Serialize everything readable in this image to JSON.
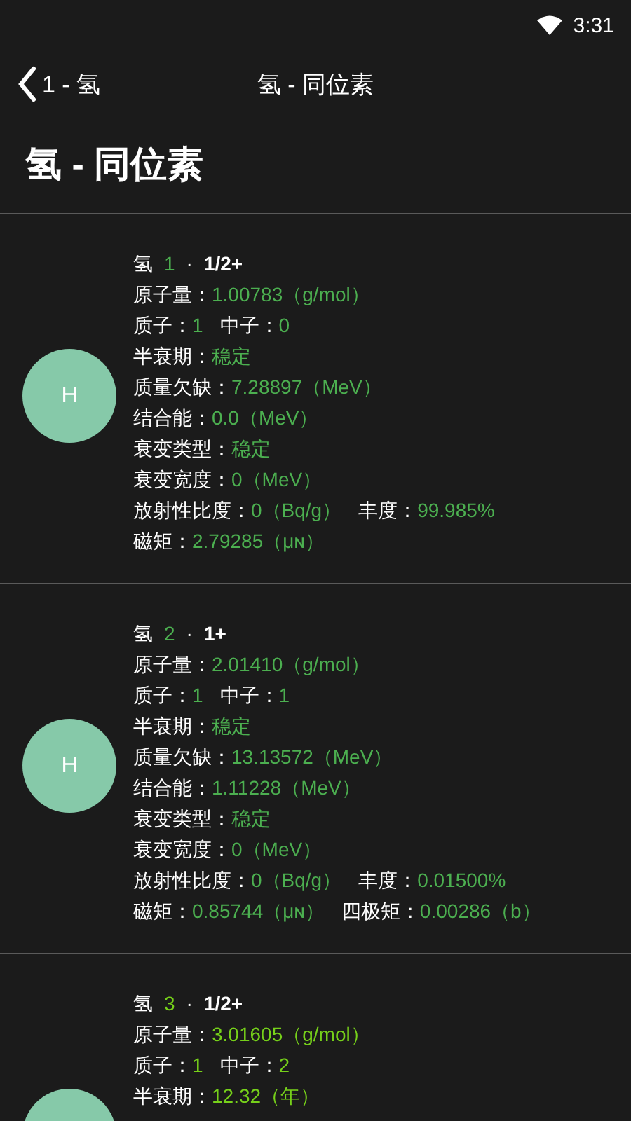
{
  "status_bar": {
    "time": "3:31"
  },
  "nav": {
    "back_label": "1 - 氢",
    "title": "氢 - 同位素"
  },
  "page_title": "氢 - 同位素",
  "isotopes": [
    {
      "symbol": "H",
      "name": "氢",
      "mass_number": "1",
      "separator": "·",
      "spin": "1/2+",
      "color": "#4caf50",
      "lines": [
        {
          "label": "原子量：",
          "value": "1.00783（g/mol）"
        },
        {
          "label": "质子：",
          "value": "1",
          "extra": {
            "label": "中子：",
            "value": "0"
          }
        },
        {
          "label": "半衰期：",
          "value": "稳定"
        },
        {
          "label": "质量欠缺：",
          "value": "7.28897（MeV）"
        },
        {
          "label": "结合能：",
          "value": "0.0（MeV）"
        },
        {
          "label": "衰变类型：",
          "value": "稳定"
        },
        {
          "label": "衰变宽度：",
          "value": "0（MeV）"
        },
        {
          "label": "放射性比度：",
          "value": "0（Bq/g）",
          "extra": {
            "label": "丰度：",
            "value": "99.985%"
          }
        },
        {
          "label": "磁矩：",
          "value": "2.79285（μɴ）"
        }
      ]
    },
    {
      "symbol": "H",
      "name": "氢",
      "mass_number": "2",
      "separator": "·",
      "spin": "1+",
      "color": "#4caf50",
      "lines": [
        {
          "label": "原子量：",
          "value": "2.01410（g/mol）"
        },
        {
          "label": "质子：",
          "value": "1",
          "extra": {
            "label": "中子：",
            "value": "1"
          }
        },
        {
          "label": "半衰期：",
          "value": "稳定"
        },
        {
          "label": "质量欠缺：",
          "value": "13.13572（MeV）"
        },
        {
          "label": "结合能：",
          "value": "1.11228（MeV）"
        },
        {
          "label": "衰变类型：",
          "value": "稳定"
        },
        {
          "label": "衰变宽度：",
          "value": "0（MeV）"
        },
        {
          "label": "放射性比度：",
          "value": "0（Bq/g）",
          "extra": {
            "label": "丰度：",
            "value": "0.01500%"
          }
        },
        {
          "label": "磁矩：",
          "value": "0.85744（μɴ）",
          "extra": {
            "label": "四极矩：",
            "value": "0.00286（b）"
          }
        }
      ]
    },
    {
      "name": "氢",
      "mass_number": "3",
      "separator": "·",
      "spin": "1/2+",
      "color": "#76d01a",
      "lines": [
        {
          "label": "原子量：",
          "value": "3.01605（g/mol）"
        },
        {
          "label": "质子：",
          "value": "1",
          "extra": {
            "label": "中子：",
            "value": "2"
          }
        },
        {
          "label": "半衰期：",
          "value": "12.32（年）"
        }
      ]
    }
  ]
}
